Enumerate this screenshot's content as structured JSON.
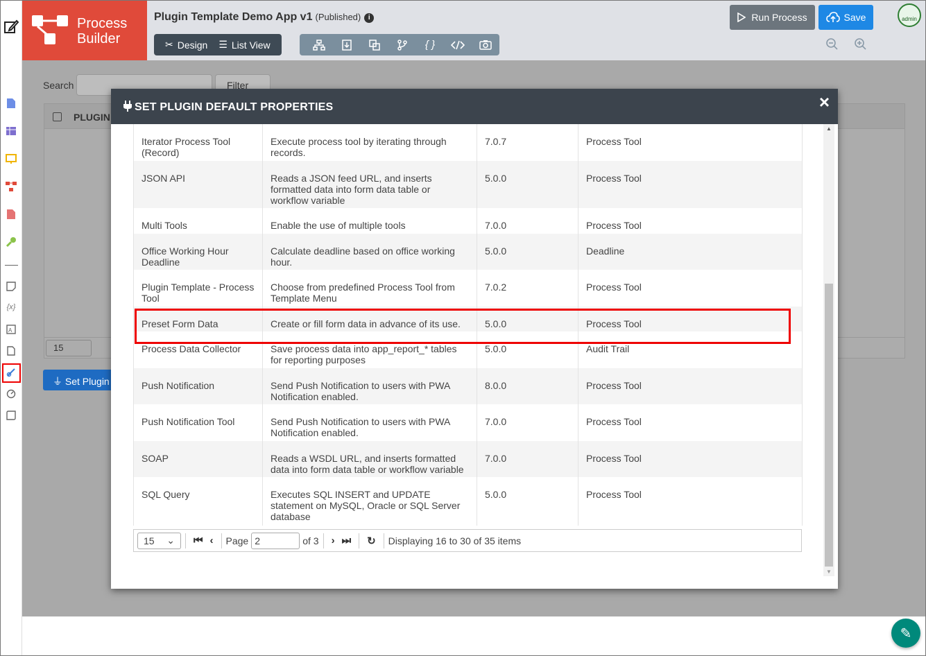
{
  "header": {
    "logo_line1": "Process",
    "logo_line2": "Builder",
    "app_title": "Plugin Template Demo App v1",
    "app_status": "(Published)",
    "design_label": "Design",
    "list_view_label": "List View",
    "run_label": "Run Process",
    "save_label": "Save",
    "avatar_label": "admin"
  },
  "page": {
    "search_label": "Search",
    "filter_label": "Filter",
    "column_label": "PLUGIN",
    "page_size": "15",
    "set_plugin_label": "Set Plugin"
  },
  "modal": {
    "title": "SET PLUGIN DEFAULT PROPERTIES",
    "close": "×",
    "rows": [
      {
        "name": "Iterator Process Tool (Record)",
        "description": "Execute process tool by iterating through records.",
        "version": "7.0.7",
        "type": "Process Tool"
      },
      {
        "name": "JSON API",
        "description": "Reads a JSON feed URL, and inserts formatted data into form data table or workflow variable",
        "version": "5.0.0",
        "type": "Process Tool"
      },
      {
        "name": "Multi Tools",
        "description": "Enable the use of multiple tools",
        "version": "7.0.0",
        "type": "Process Tool"
      },
      {
        "name": "Office Working Hour Deadline",
        "description": "Calculate deadline based on office working hour.",
        "version": "5.0.0",
        "type": "Deadline"
      },
      {
        "name": "Plugin Template - Process Tool",
        "description": "Choose from predefined Process Tool from Template Menu",
        "version": "7.0.2",
        "type": "Process Tool"
      },
      {
        "name": "Preset Form Data",
        "description": "Create or fill form data in advance of its use.",
        "version": "5.0.0",
        "type": "Process Tool"
      },
      {
        "name": "Process Data Collector",
        "description": "Save process data into app_report_* tables for reporting purposes",
        "version": "5.0.0",
        "type": "Audit Trail"
      },
      {
        "name": "Push Notification",
        "description": "Send Push Notification to users with PWA Notification enabled.",
        "version": "8.0.0",
        "type": "Process Tool"
      },
      {
        "name": "Push Notification Tool",
        "description": "Send Push Notification to users with PWA Notification enabled.",
        "version": "7.0.0",
        "type": "Process Tool"
      },
      {
        "name": "SOAP",
        "description": "Reads a WSDL URL, and inserts formatted data into form data table or workflow variable",
        "version": "7.0.0",
        "type": "Process Tool"
      },
      {
        "name": "SQL Query",
        "description": "Executes SQL INSERT and UPDATE statement on MySQL, Oracle or SQL Server database",
        "version": "5.0.0",
        "type": "Process Tool"
      }
    ],
    "pager": {
      "page_size": "15",
      "page_label": "Page",
      "page_value": "2",
      "of_label": "of 3",
      "display_text": "Displaying 16 to 30 of 35 items"
    }
  },
  "colors": {
    "logo": "#e04a3a",
    "modal_header": "#3c444d",
    "primary": "#1e88e5",
    "highlight": "#ee0000"
  }
}
